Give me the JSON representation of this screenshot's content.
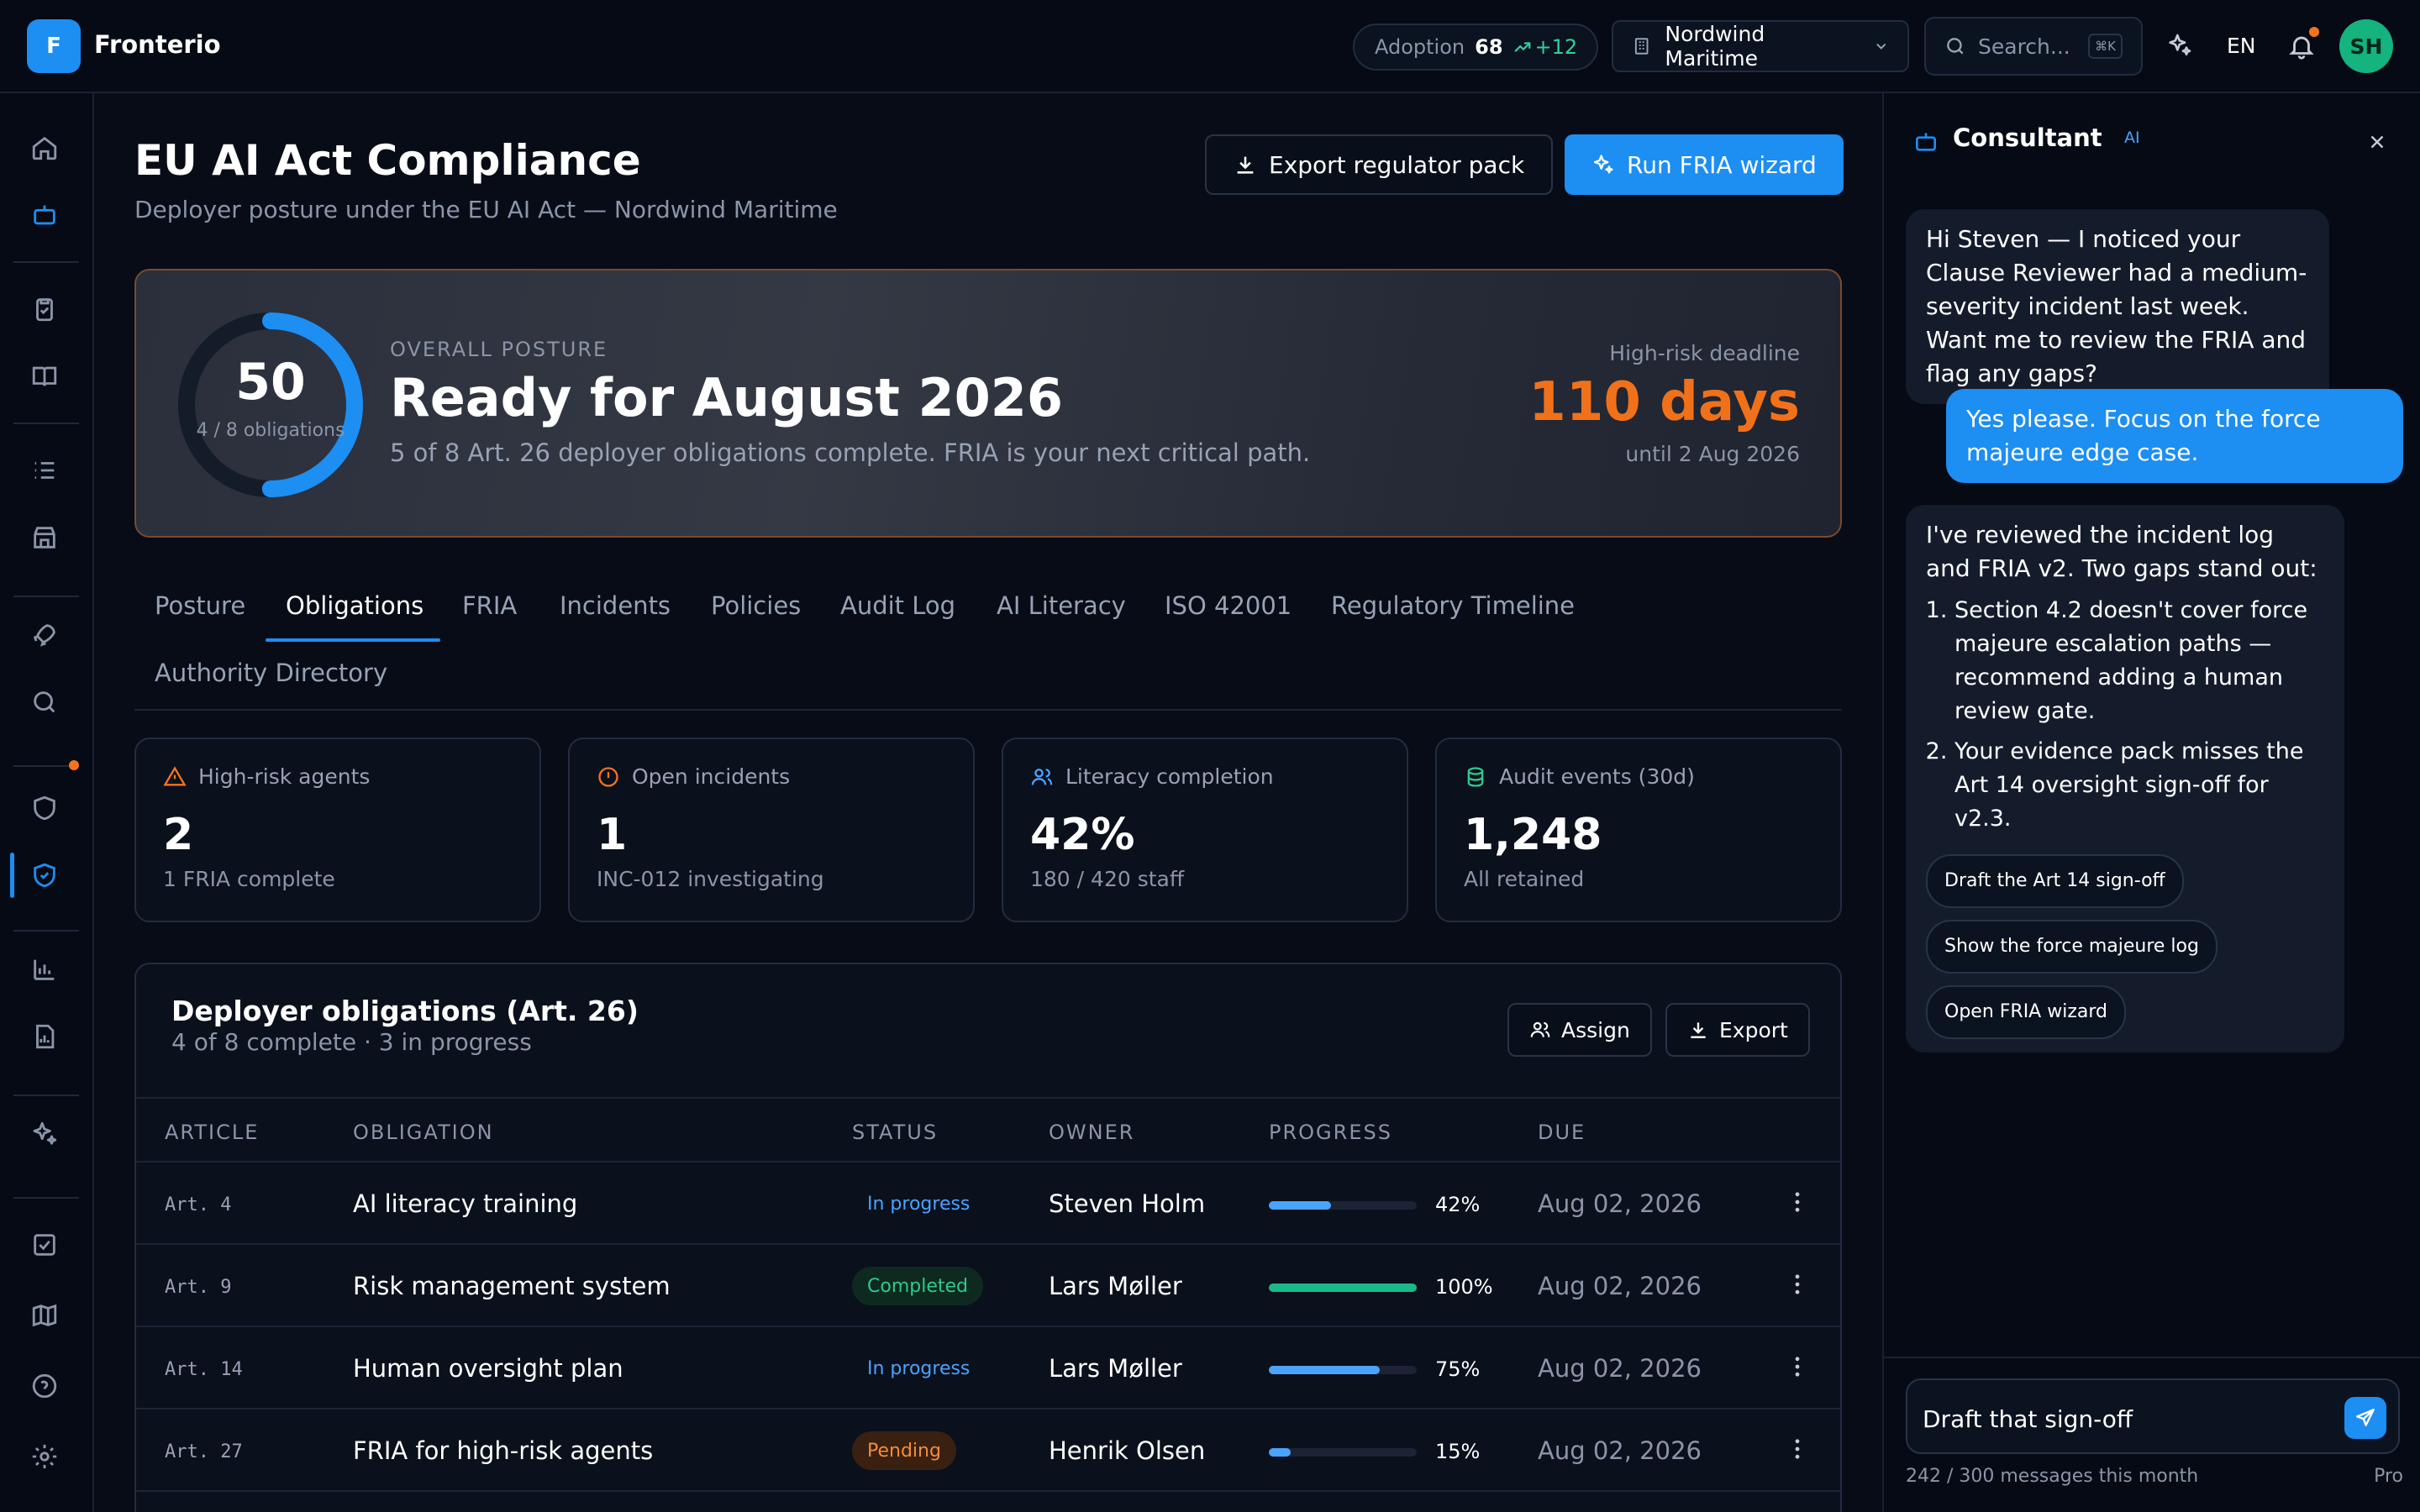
{
  "app": {
    "logo_letter": "F",
    "name": "Fronterio"
  },
  "topbar": {
    "adoption_label": "Adoption",
    "adoption_score": "68",
    "adoption_delta": "+12",
    "tenant": "Nordwind Maritime",
    "search_placeholder": "Search...",
    "search_shortcut": "⌘K",
    "language": "EN",
    "avatar_initials": "SH"
  },
  "page": {
    "title": "EU AI Act Compliance",
    "subtitle": "Deployer posture under the EU AI Act — Nordwind Maritime",
    "export_label": "Export regulator pack",
    "wizard_label": "Run FRIA wizard"
  },
  "hero": {
    "score": "50",
    "score_progress": 0.5,
    "score_sub": "4 / 8 obligations",
    "kicker": "OVERALL POSTURE",
    "title": "Ready for August 2026",
    "description": "5 of 8 Art. 26 deployer obligations complete. FRIA is your next critical path.",
    "deadline_label": "High-risk deadline",
    "deadline_value": "110 days",
    "deadline_sub": "until 2 Aug 2026"
  },
  "tabs": [
    "Posture",
    "Obligations",
    "FRIA",
    "Incidents",
    "Policies",
    "Audit Log",
    "AI Literacy",
    "ISO 42001",
    "Regulatory Timeline",
    "Authority Directory"
  ],
  "active_tab": "Obligations",
  "kpis": [
    {
      "label": "High-risk agents",
      "value": "2",
      "sub": "1 FRIA complete",
      "icon": "warning-icon",
      "color": "#f5731e"
    },
    {
      "label": "Open incidents",
      "value": "1",
      "sub": "INC-012 investigating",
      "icon": "alert-circle-icon",
      "color": "#f5731e"
    },
    {
      "label": "Literacy completion",
      "value": "42%",
      "sub": "180 / 420 staff",
      "icon": "users-icon",
      "color": "#4aa3ff"
    },
    {
      "label": "Audit events (30d)",
      "value": "1,248",
      "sub": "All retained",
      "icon": "database-icon",
      "color": "#2fc98f"
    }
  ],
  "obligations": {
    "title": "Deployer obligations (Art. 26)",
    "subtitle": "4 of 8 complete · 3 in progress",
    "assign_label": "Assign",
    "export_label": "Export",
    "columns": [
      "ARTICLE",
      "OBLIGATION",
      "STATUS",
      "OWNER",
      "PROGRESS",
      "DUE"
    ],
    "rows": [
      {
        "article": "Art. 4",
        "obligation": "AI literacy training",
        "status": "In progress",
        "status_kind": "prog",
        "owner": "Steven Holm",
        "progress": 42,
        "progress_label": "42%",
        "due": "Aug 02, 2026"
      },
      {
        "article": "Art. 9",
        "obligation": "Risk management system",
        "status": "Completed",
        "status_kind": "done",
        "owner": "Lars Møller",
        "progress": 100,
        "progress_label": "100%",
        "due": "Aug 02, 2026"
      },
      {
        "article": "Art. 14",
        "obligation": "Human oversight plan",
        "status": "In progress",
        "status_kind": "prog",
        "owner": "Lars Møller",
        "progress": 75,
        "progress_label": "75%",
        "due": "Aug 02, 2026"
      },
      {
        "article": "Art. 27",
        "obligation": "FRIA for high-risk agents",
        "status": "Pending",
        "status_kind": "pend",
        "owner": "Henrik Olsen",
        "progress": 15,
        "progress_label": "15%",
        "due": "Aug 02, 2026"
      }
    ]
  },
  "consultant": {
    "title": "Consultant",
    "badge": "AI",
    "msg1": "Hi Steven — I noticed your Clause Reviewer had a medium-severity incident last week. Want me to review the FRIA and flag any gaps?",
    "msg2": "Yes please. Focus on the force majeure edge case.",
    "msg3_intro": "I've reviewed the incident log and FRIA v2. Two gaps stand out:",
    "msg3_items": [
      "Section 4.2 doesn't cover force majeure escalation paths — recommend adding a human review gate.",
      "Your evidence pack misses the Art 14 oversight sign-off for v2.3."
    ],
    "chips": [
      "Draft the Art 14 sign-off",
      "Show the force majeure log",
      "Open FRIA wizard"
    ],
    "input_value": "Draft that sign-off",
    "quota": "242 / 300 messages this month",
    "plan": "Pro"
  },
  "colors": {
    "accent": "#1d8ef2",
    "warning": "#f0711a",
    "success": "#2fc98f"
  }
}
